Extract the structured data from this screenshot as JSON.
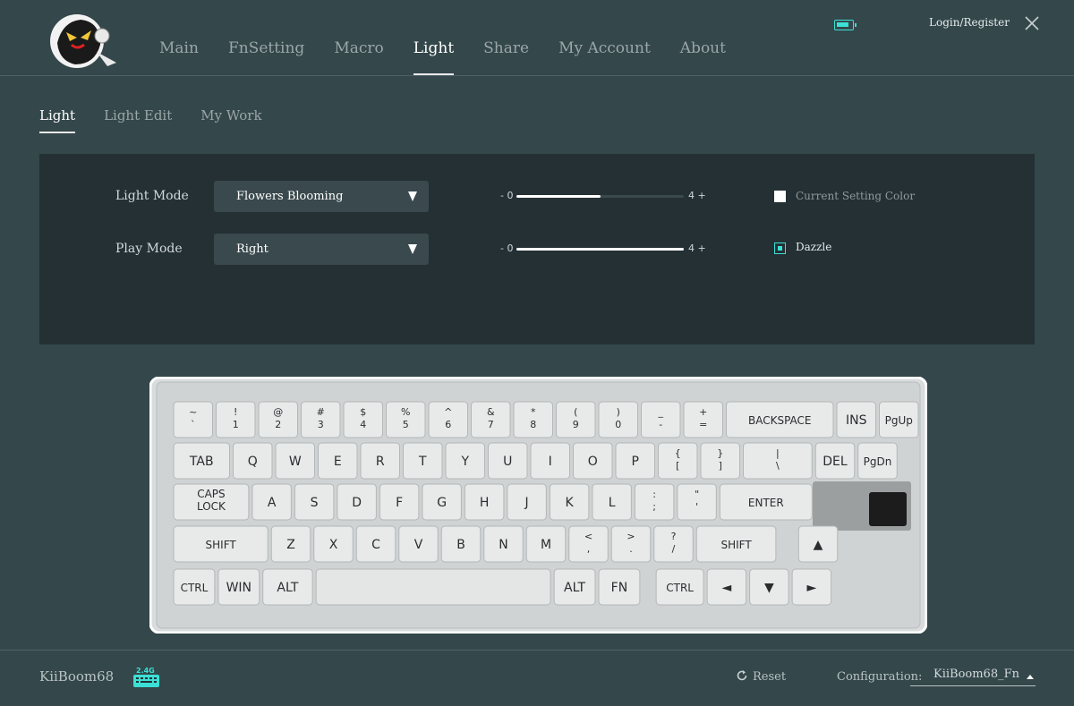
{
  "nav": {
    "items": [
      "Main",
      "FnSetting",
      "Macro",
      "Light",
      "Share",
      "My Account",
      "About"
    ],
    "active": "Light"
  },
  "header": {
    "login_label": "Login/Register"
  },
  "subtabs": {
    "items": [
      "Light",
      "Light Edit",
      "My Work"
    ],
    "active": "Light"
  },
  "light_panel": {
    "light_mode_label": "Light Mode",
    "light_mode_value": "Flowers Blooming",
    "play_mode_label": "Play Mode",
    "play_mode_value": "Right",
    "brightness": {
      "min_label": "- 0",
      "max_label": "4 +",
      "value_fraction": 0.5
    },
    "speed": {
      "min_label": "- 0",
      "max_label": "4 +",
      "value_fraction": 1.0
    },
    "current_color_label": "Current Setting Color",
    "dazzle_label": "Dazzle",
    "dazzle_checked": true
  },
  "keyboard": {
    "rows": [
      [
        [
          "~",
          "`"
        ],
        [
          "!",
          "1"
        ],
        [
          "@",
          "2"
        ],
        [
          "#",
          "3"
        ],
        [
          "$",
          "4"
        ],
        [
          "%",
          "5"
        ],
        [
          "^",
          "6"
        ],
        [
          "&",
          "7"
        ],
        [
          "*",
          "8"
        ],
        [
          "(",
          "9"
        ],
        [
          ")",
          "0"
        ],
        [
          "_",
          "-"
        ],
        [
          "+",
          "="
        ],
        [
          "BACKSPACE"
        ],
        [
          "INS"
        ],
        [
          "PgUp"
        ]
      ],
      [
        [
          "TAB"
        ],
        [
          "Q"
        ],
        [
          "W"
        ],
        [
          "E"
        ],
        [
          "R"
        ],
        [
          "T"
        ],
        [
          "Y"
        ],
        [
          "U"
        ],
        [
          "I"
        ],
        [
          "O"
        ],
        [
          "P"
        ],
        [
          "{",
          "["
        ],
        [
          "}",
          "]"
        ],
        [
          "|",
          "\\"
        ],
        [
          "DEL"
        ],
        [
          "PgDn"
        ]
      ],
      [
        [
          "CAPS",
          "LOCK"
        ],
        [
          "A"
        ],
        [
          "S"
        ],
        [
          "D"
        ],
        [
          "F"
        ],
        [
          "G"
        ],
        [
          "H"
        ],
        [
          "J"
        ],
        [
          "K"
        ],
        [
          "L"
        ],
        [
          ":",
          ";"
        ],
        [
          "\"",
          "'"
        ],
        [
          "ENTER"
        ]
      ],
      [
        [
          "SHIFT"
        ],
        [
          "Z"
        ],
        [
          "X"
        ],
        [
          "C"
        ],
        [
          "V"
        ],
        [
          "B"
        ],
        [
          "N"
        ],
        [
          "M"
        ],
        [
          "<",
          ","
        ],
        [
          ">",
          "."
        ],
        [
          "?",
          "/"
        ],
        [
          "SHIFT"
        ],
        [
          "▲"
        ]
      ],
      [
        [
          "CTRL"
        ],
        [
          "WIN"
        ],
        [
          "ALT"
        ],
        [
          "ALT"
        ],
        [
          "FN"
        ],
        [
          "CTRL"
        ],
        [
          "◄"
        ],
        [
          "▼"
        ],
        [
          "►"
        ]
      ]
    ]
  },
  "footer": {
    "device_name": "KiiBoom68",
    "dongle_label": "2.4G",
    "reset_label": "Reset",
    "config_label": "Configuration:",
    "config_value": "KiiBoom68_Fn"
  },
  "colors": {
    "accent": "#3be0d6",
    "bg": "#34474b",
    "panel": "#243034"
  }
}
